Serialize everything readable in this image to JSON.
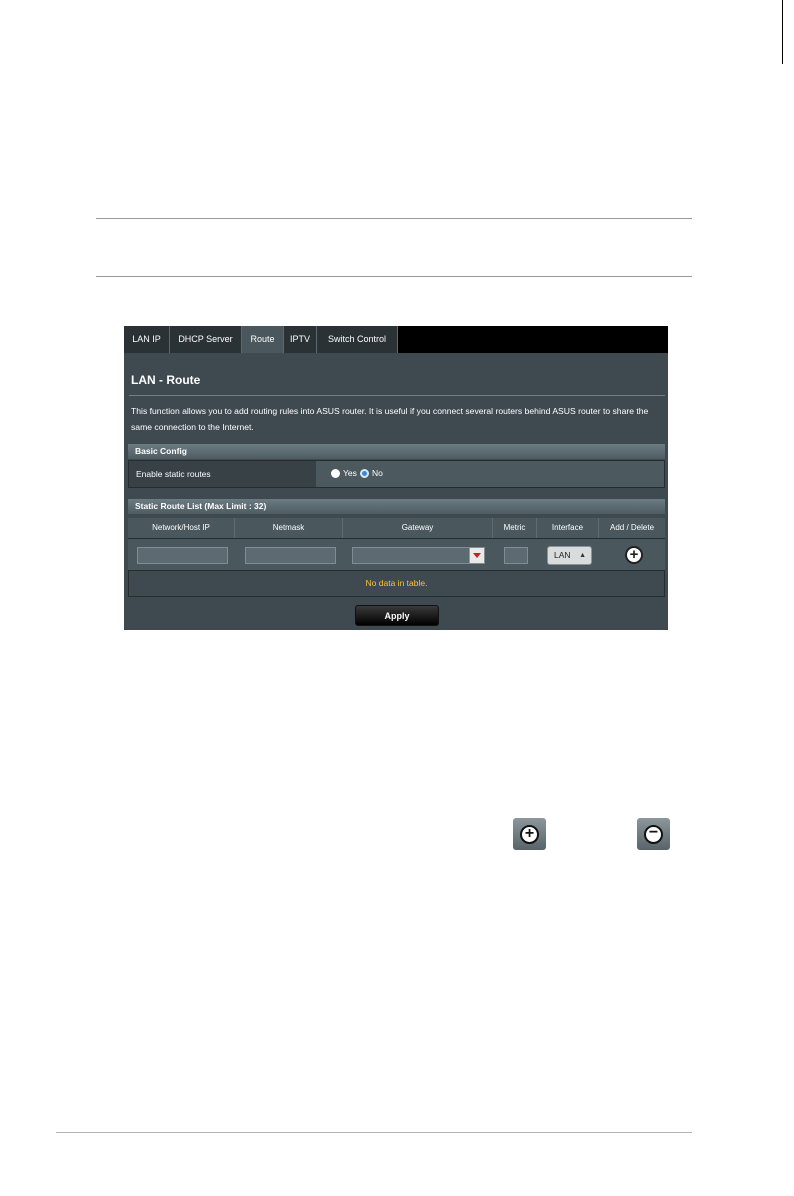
{
  "tabs": [
    "LAN IP",
    "DHCP Server",
    "Route",
    "IPTV",
    "Switch Control"
  ],
  "active_tab": "Route",
  "page_title": "LAN - Route",
  "description": "This function allows you to add routing rules into ASUS router. It is useful if you connect several routers behind ASUS router to share the same connection to the Internet.",
  "basic_config": {
    "header": "Basic Config",
    "label": "Enable static routes",
    "yes_label": "Yes",
    "no_label": "No",
    "selected": "No"
  },
  "route_list": {
    "header": "Static Route List (Max Limit : 32)",
    "columns": [
      "Network/Host IP",
      "Netmask",
      "Gateway",
      "Metric",
      "Interface",
      "Add / Delete"
    ],
    "interface_value": "LAN",
    "empty_text": "No data in table."
  },
  "apply_label": "Apply",
  "icons": {
    "add": "plus-circle-icon",
    "delete": "minus-circle-icon"
  },
  "colors": {
    "panel_bg": "#3f4a50",
    "no_data_text": "#ffc13a",
    "radio_selected": "#3d88d9"
  }
}
